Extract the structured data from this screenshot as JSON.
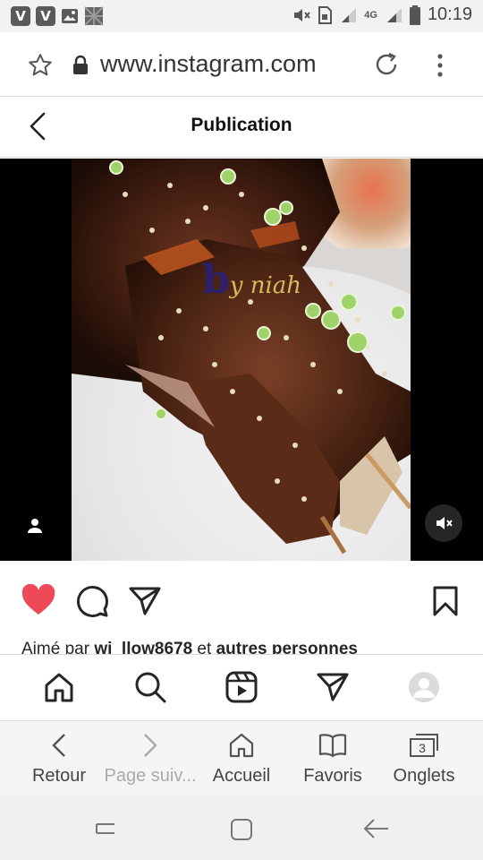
{
  "status_bar": {
    "time": "10:19",
    "network": "4G",
    "app_icons": [
      "V",
      "V"
    ]
  },
  "browser": {
    "url": "www.instagram.com"
  },
  "post_header": {
    "title": "Publication"
  },
  "media": {
    "watermark_initial": "b",
    "watermark_text": "y niah"
  },
  "likes": {
    "prefix": "Aimé par ",
    "user": "wi_llow8678",
    "middle": " et ",
    "others": "autres personnes"
  },
  "browser_toolbar": {
    "items": [
      {
        "label": "Retour"
      },
      {
        "label": "Page suiv..."
      },
      {
        "label": "Accueil"
      },
      {
        "label": "Favoris"
      },
      {
        "label": "Onglets",
        "badge": "3"
      }
    ]
  },
  "colors": {
    "like_red": "#ed4956",
    "ig_text": "#262626"
  }
}
